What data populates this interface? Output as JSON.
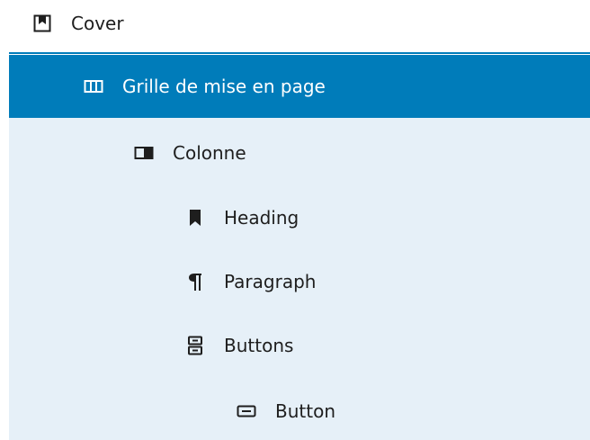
{
  "tree": {
    "cover": {
      "label": "Cover",
      "icon": "cover-icon"
    },
    "grid": {
      "label": "Grille de mise en page",
      "icon": "columns-icon",
      "selected": true
    },
    "column": {
      "label": "Colonne",
      "icon": "column-icon"
    },
    "heading": {
      "label": "Heading",
      "icon": "heading-bookmark-icon"
    },
    "paragraph": {
      "label": "Paragraph",
      "icon": "paragraph-icon"
    },
    "buttons": {
      "label": "Buttons",
      "icon": "buttons-icon"
    },
    "button": {
      "label": "Button",
      "icon": "button-icon"
    }
  },
  "colors": {
    "selected_bg": "#007cba",
    "descendant_bg": "#e6f0f8",
    "text": "#1e1e1e",
    "selected_text": "#ffffff"
  }
}
